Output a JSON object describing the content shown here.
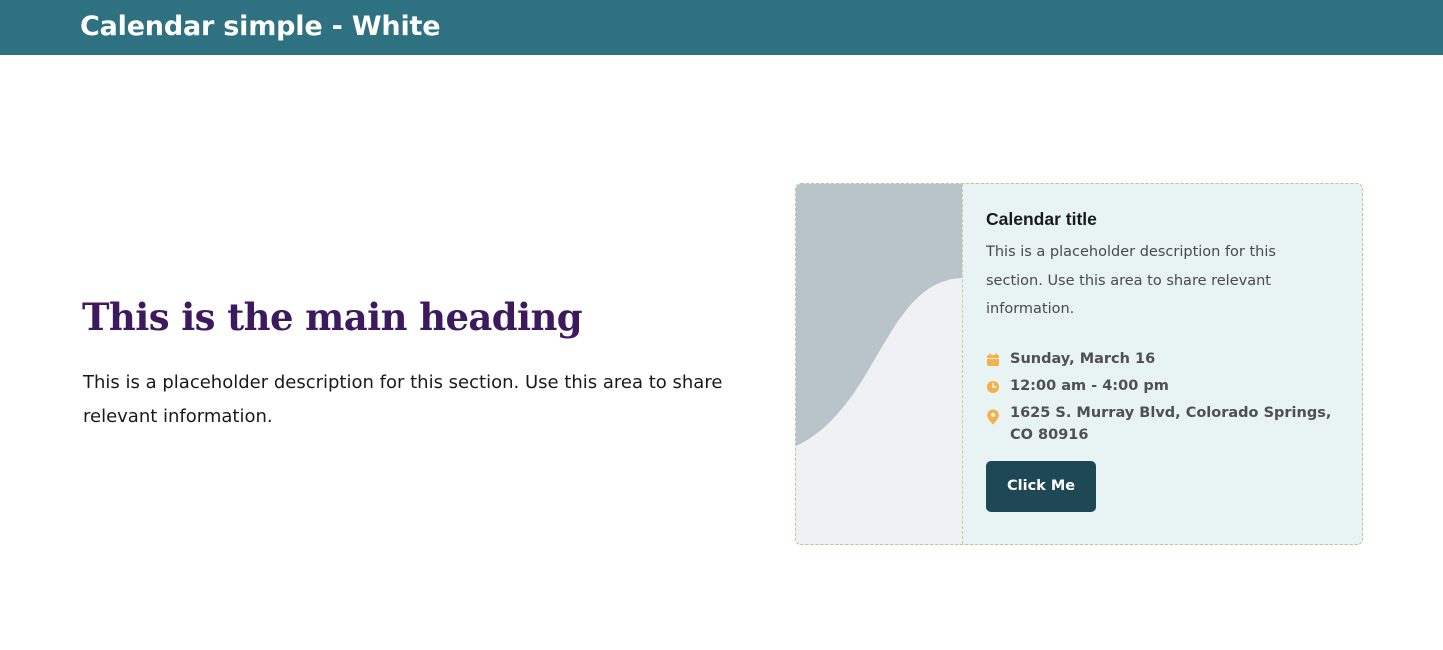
{
  "header": {
    "title": "Calendar simple - White",
    "background_color": "#2e7282"
  },
  "hero": {
    "heading": "This is the main heading",
    "heading_color": "#3d1a5e",
    "description": "This is a placeholder description for this section. Use this area to share relevant information."
  },
  "card": {
    "title": "Calendar title",
    "description": "This is a placeholder description for this section. Use this area to share relevant information.",
    "date": "Sunday, March 16",
    "time": "12:00 am - 4:00 pm",
    "location": "1625 S. Murray Blvd, Colorado Springs, CO 80916",
    "button_label": "Click Me",
    "icons": {
      "date": "calendar-icon",
      "time": "clock-icon",
      "location": "map-pin-icon"
    },
    "accent_color": "#f5b04a",
    "button_color": "#1f4855",
    "background_color": "#e8f3f4"
  }
}
